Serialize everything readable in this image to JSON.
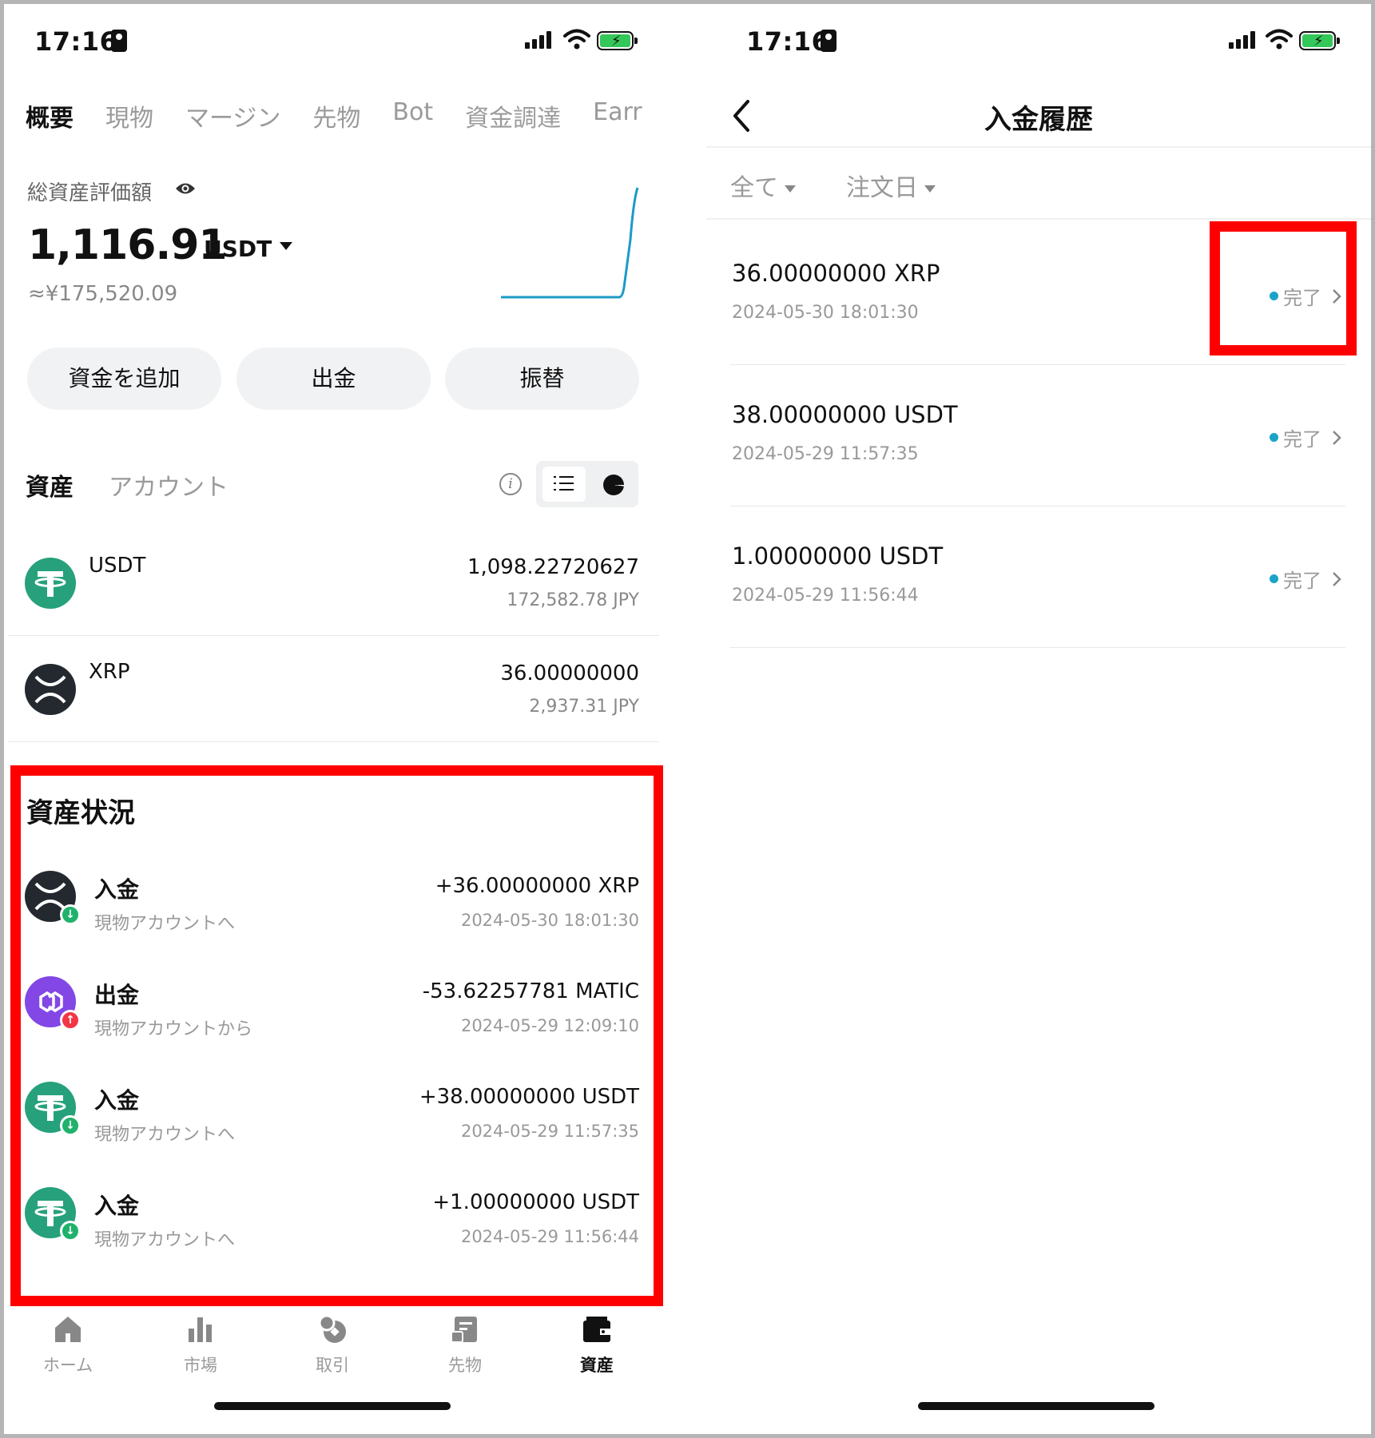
{
  "left": {
    "status_time": "17:16",
    "tabs": [
      "概要",
      "現物",
      "マージン",
      "先物",
      "Bot",
      "資金調達",
      "Earr"
    ],
    "total_label": "総資産評価額",
    "total_value": "1,116.91",
    "total_unit": "USDT",
    "total_jpy": "≈¥175,520.09",
    "actions": [
      "資金を追加",
      "出金",
      "振替"
    ],
    "asset_tabs": [
      "資産",
      "アカウント"
    ],
    "assets": [
      {
        "symbol": "USDT",
        "amount": "1,098.22720627",
        "fiat": "172,582.78 JPY",
        "icon": "tether-icon"
      },
      {
        "symbol": "XRP",
        "amount": "36.00000000",
        "fiat": "2,937.31 JPY",
        "icon": "xrp-icon"
      }
    ],
    "history_title": "資産状況",
    "history": [
      {
        "type": "入金",
        "sub": "現物アカウントへ",
        "amount": "+36.00000000 XRP",
        "date": "2024-05-30 18:01:30",
        "icon": "xrp-icon",
        "direction": "in"
      },
      {
        "type": "出金",
        "sub": "現物アカウントから",
        "amount": "-53.62257781 MATIC",
        "date": "2024-05-29 12:09:10",
        "icon": "matic-icon",
        "direction": "out"
      },
      {
        "type": "入金",
        "sub": "現物アカウントへ",
        "amount": "+38.00000000 USDT",
        "date": "2024-05-29 11:57:35",
        "icon": "tether-icon",
        "direction": "in"
      },
      {
        "type": "入金",
        "sub": "現物アカウントへ",
        "amount": "+1.00000000 USDT",
        "date": "2024-05-29 11:56:44",
        "icon": "tether-icon",
        "direction": "in"
      }
    ],
    "nav": [
      {
        "label": "ホーム",
        "icon": "home-icon",
        "active": false
      },
      {
        "label": "市場",
        "icon": "market-icon",
        "active": false
      },
      {
        "label": "取引",
        "icon": "trade-icon",
        "active": false
      },
      {
        "label": "先物",
        "icon": "futures-icon",
        "active": false
      },
      {
        "label": "資産",
        "icon": "wallet-icon",
        "active": true
      }
    ]
  },
  "right": {
    "status_time": "17:16",
    "title": "入金履歴",
    "filters": [
      "全て",
      "注文日"
    ],
    "deposits": [
      {
        "amount": "36.00000000 XRP",
        "date": "2024-05-30 18:01:30",
        "status": "完了"
      },
      {
        "amount": "38.00000000 USDT",
        "date": "2024-05-29 11:57:35",
        "status": "完了"
      },
      {
        "amount": "1.00000000 USDT",
        "date": "2024-05-29 11:56:44",
        "status": "完了"
      }
    ]
  },
  "colors": {
    "highlight": "#ff0000",
    "tether": "#26a17b",
    "xrp": "#23292f",
    "matic": "#8247e5",
    "status_dot": "#1aa3c8",
    "sparkline": "#1b9bc5"
  }
}
